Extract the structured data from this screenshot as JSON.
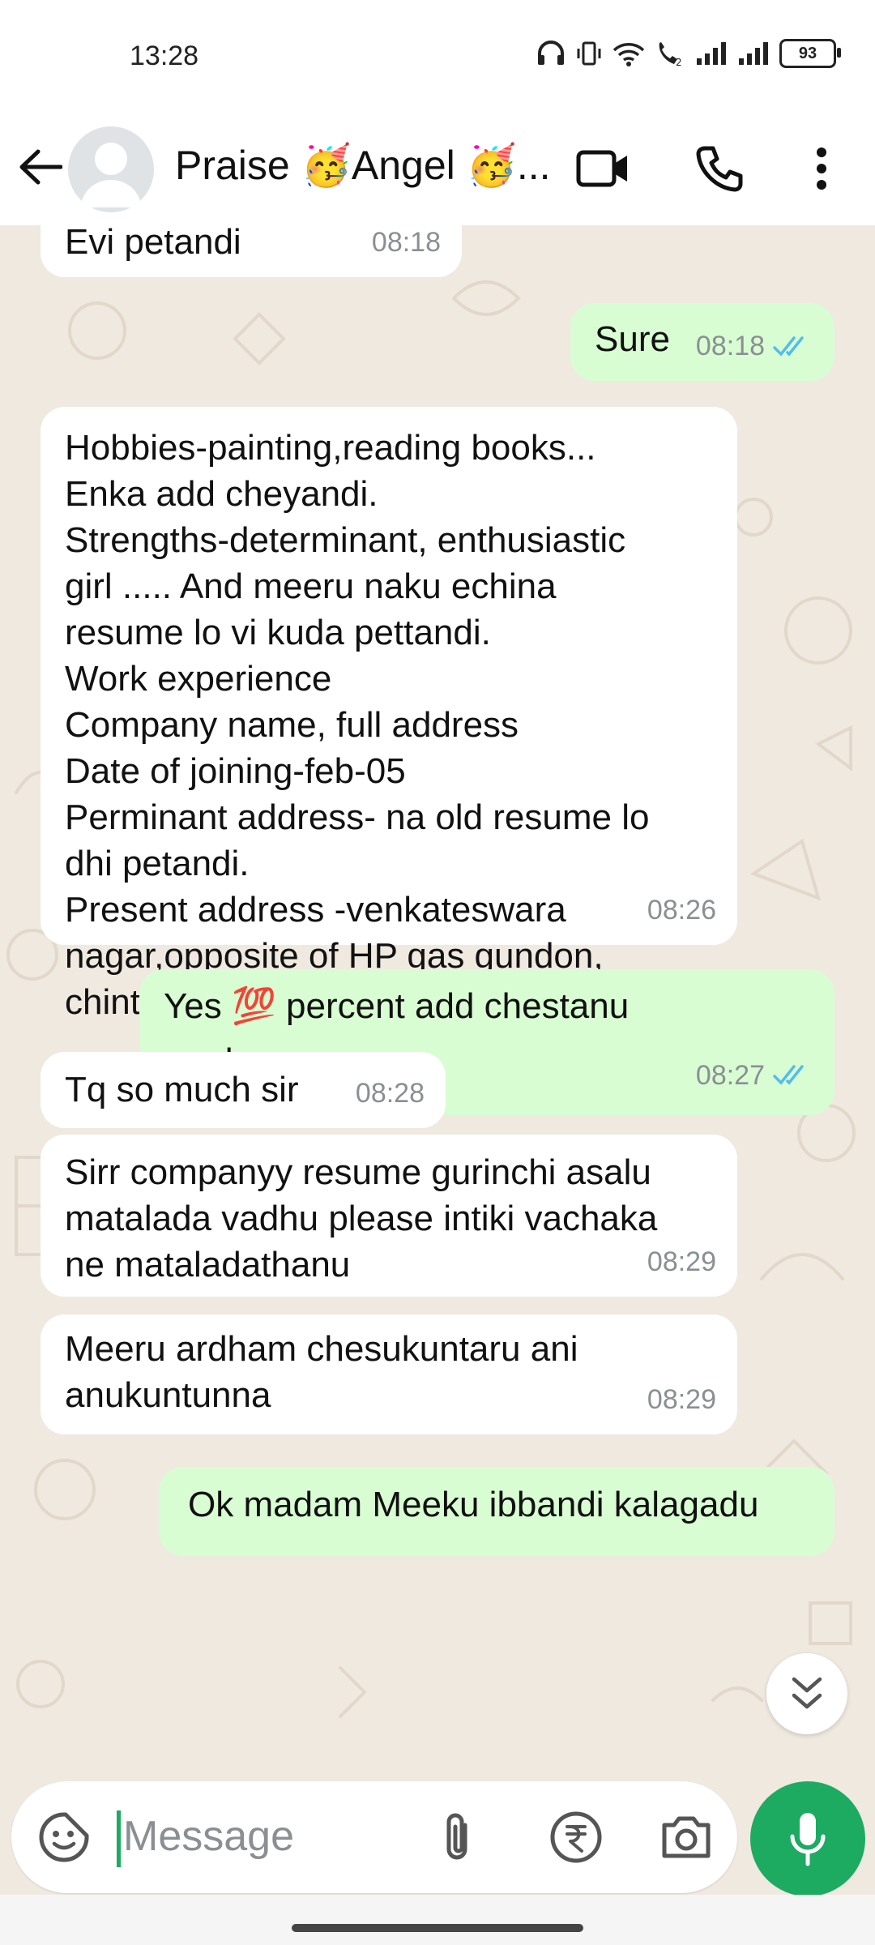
{
  "status_bar": {
    "time": "13:28",
    "battery": "93"
  },
  "header": {
    "contact_name": "Praise 🥳Angel 🥳...",
    "icons": [
      "back-arrow-icon",
      "avatar",
      "video-call-icon",
      "voice-call-icon",
      "more-options-icon"
    ]
  },
  "messages": [
    {
      "dir": "in",
      "text": "Evi petandi",
      "time": "08:18"
    },
    {
      "dir": "out",
      "text": "Sure",
      "time": "08:18",
      "ticks": "read"
    },
    {
      "dir": "in",
      "text": "Hobbies-painting,reading books...\nEnka add cheyandi.\nStrengths-determinant, enthusiastic\ngirl ..... And meeru naku echina\nresume lo vi kuda pettandi.\nWork experience\nCompany name, full address\nDate of joining-feb-05\nPerminant address- na old resume lo\ndhi petandi.\nPresent address -venkateswara\nnagar,opposite of HP gas gundon,\nchintal, hyderabad evvani pettandi",
      "time": "08:26"
    },
    {
      "dir": "out",
      "text": "Yes 💯 percent add chestanu\nmadam garu",
      "time": "08:27",
      "ticks": "read"
    },
    {
      "dir": "in",
      "text": "Tq so much sir",
      "time": "08:28"
    },
    {
      "dir": "in",
      "text": "Sirr companyy resume gurinchi asalu\nmatalada vadhu please intiki vachaka\nne mataladathanu",
      "time": "08:29"
    },
    {
      "dir": "in",
      "text": "Meeru ardham chesukuntaru ani\nanukuntunna",
      "time": "08:29"
    },
    {
      "dir": "out",
      "text": "Ok madam Meeku ibbandi kalagadu",
      "time": ""
    }
  ],
  "composer": {
    "placeholder": "Message"
  },
  "colors": {
    "outgoing_bubble": "#d9fdd3",
    "incoming_bubble": "#ffffff",
    "chat_background": "#efe9e0",
    "accent_green": "#1daa61",
    "read_tick_blue": "#53bdeb"
  }
}
